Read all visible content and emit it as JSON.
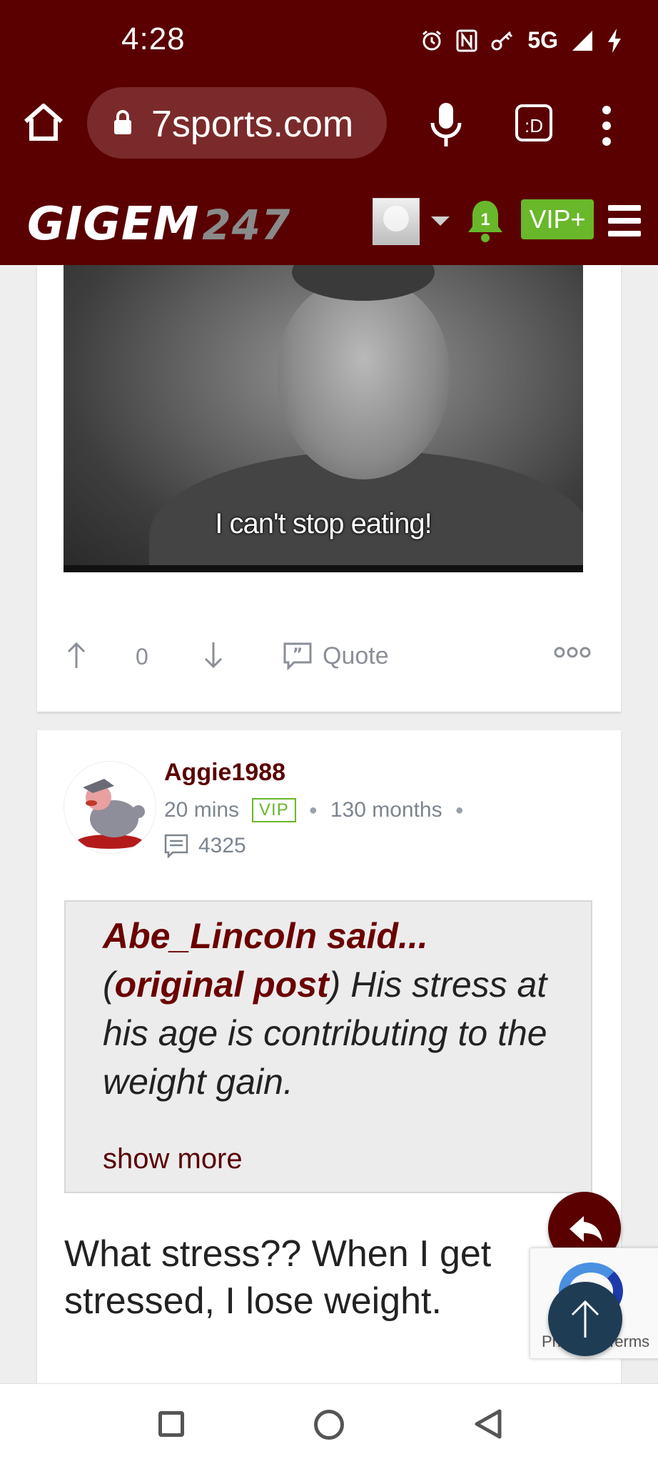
{
  "status_bar": {
    "time": "4:28",
    "network": "5G",
    "icons": [
      "alarm-icon",
      "nfc-icon",
      "key-icon",
      "signal-icon",
      "charging-icon"
    ]
  },
  "browser": {
    "url": "7sports.com",
    "tabs_label": ":D"
  },
  "site_header": {
    "logo_text": "GIGEM",
    "logo_number": "247",
    "notification_count": "1",
    "vip_label": "VIP+"
  },
  "post1": {
    "gif_caption": "I can't stop eating!",
    "vote_count": "0",
    "quote_label": "Quote"
  },
  "post2": {
    "username": "Aggie1988",
    "time_ago": "20 mins",
    "badge": "VIP",
    "tenure": "130 months",
    "post_count": "4325",
    "quoted_author": "Abe_Lincoln said...",
    "quoted_open_paren": "(",
    "quoted_link": "original post",
    "quoted_text": ") His stress at his age is contributing to the weight gain.",
    "show_more": "show more",
    "reply_text": "What stress?? When I get stressed, I lose weight."
  },
  "recaptcha": {
    "links_text": "Privacy - Terms"
  },
  "colors": {
    "brand_maroon": "#5a0000",
    "vip_green": "#69b72a",
    "fab_top_blue": "#1f3c55"
  }
}
